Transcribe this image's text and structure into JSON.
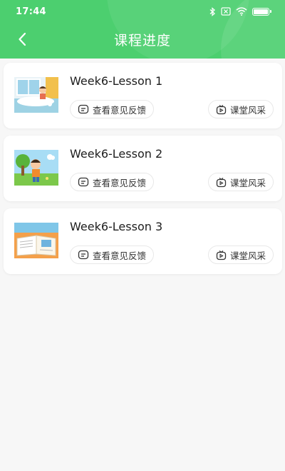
{
  "status": {
    "time": "17:44"
  },
  "header": {
    "title": "课程进度",
    "background_color": "#4ccf6f"
  },
  "lessons": [
    {
      "title": "Week6-Lesson 1",
      "feedback_label": "查看意见反馈",
      "showcase_label": "课堂风采",
      "thumbnail": "bath-scene-illustration"
    },
    {
      "title": "Week6-Lesson 2",
      "feedback_label": "查看意见反馈",
      "showcase_label": "课堂风采",
      "thumbnail": "park-boy-illustration"
    },
    {
      "title": "Week6-Lesson 3",
      "feedback_label": "查看意见反馈",
      "showcase_label": "课堂风采",
      "thumbnail": "open-book-illustration"
    }
  ]
}
